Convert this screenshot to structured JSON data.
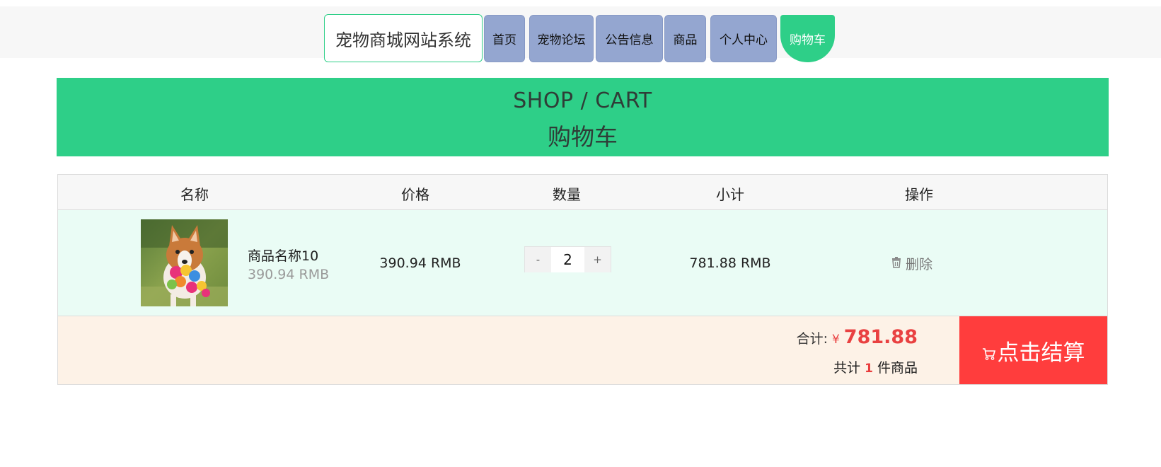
{
  "header": {
    "brand": "宠物商城网站系统",
    "nav": [
      {
        "label": "首页"
      },
      {
        "label": "宠物论坛"
      },
      {
        "label": "公告信息"
      },
      {
        "label": "商品"
      },
      {
        "label": "个人中心"
      },
      {
        "label": "购物车"
      }
    ],
    "active": "购物车"
  },
  "banner": {
    "title_en": "SHOP / CART",
    "title_cn": "购物车"
  },
  "table": {
    "columns": [
      "名称",
      "价格",
      "数量",
      "小计",
      "操作"
    ],
    "rows": [
      {
        "image": "corgi-with-toy-photo",
        "name": "商品名称10",
        "unit_price": "390.94 RMB",
        "price": "390.94 RMB",
        "qty": "2",
        "minus": "-",
        "plus": "+",
        "subtotal": "781.88 RMB",
        "action_icon": "trash-icon",
        "action": "删除"
      }
    ]
  },
  "summary": {
    "total_label": "合计:",
    "currency": "¥",
    "total": "781.88",
    "count_prefix": "共计",
    "count": "1",
    "count_suffix": "件商品",
    "checkout_icon": "cart-icon",
    "checkout": "点击结算"
  },
  "colors": {
    "accent": "#2ecf88",
    "nav": "#94a6d0",
    "danger": "#ff3d3d",
    "row_bg": "#eafcf5",
    "footer_bg": "#fdf2e7"
  }
}
